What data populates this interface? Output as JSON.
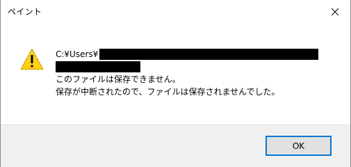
{
  "window": {
    "title": "ペイント"
  },
  "icons": {
    "close": "close-icon",
    "warning": "warning-icon"
  },
  "message": {
    "path_prefix": "C:¥Users¥",
    "line1": "このファイルは保存できません。",
    "line2": "保存が中断されたので、ファイルは保存されませんでした。"
  },
  "buttons": {
    "ok_label": "OK"
  },
  "colors": {
    "accent": "#0078d7",
    "warning_fill": "#fcd116",
    "footer_bg": "#f0f0f0"
  }
}
